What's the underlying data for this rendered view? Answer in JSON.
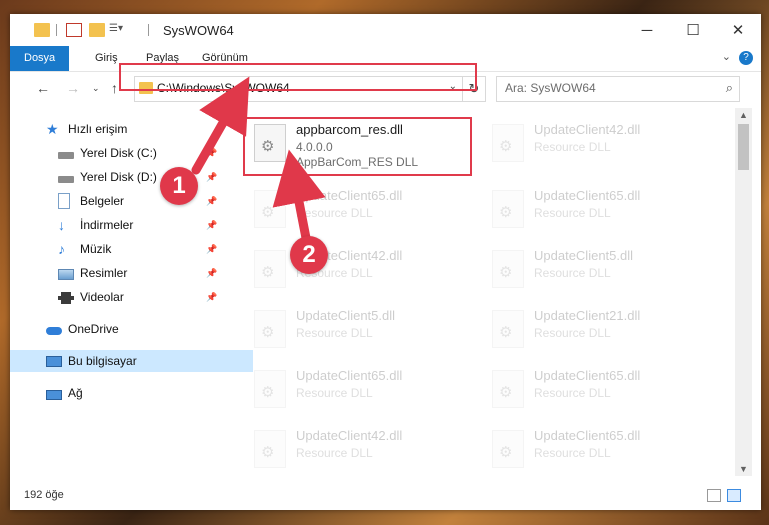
{
  "window": {
    "title": "SysWOW64"
  },
  "ribbon": {
    "tabs": [
      {
        "label": "Dosya",
        "active": true
      },
      {
        "label": "Giriş",
        "active": false
      },
      {
        "label": "Paylaş",
        "active": false
      },
      {
        "label": "Görünüm",
        "active": false
      }
    ]
  },
  "address": {
    "path": "C:\\Windows\\SysWOW64"
  },
  "search": {
    "placeholder": "Ara: SysWOW64"
  },
  "sidebar": {
    "items": [
      {
        "label": "Hızlı erişim",
        "icon": "star-icon"
      },
      {
        "label": "Yerel Disk (C:)",
        "icon": "drive-icon"
      },
      {
        "label": "Yerel Disk (D:)",
        "icon": "drive-icon"
      },
      {
        "label": "Belgeler",
        "icon": "document-icon"
      },
      {
        "label": "İndirmeler",
        "icon": "download-icon"
      },
      {
        "label": "Müzik",
        "icon": "music-icon"
      },
      {
        "label": "Resimler",
        "icon": "pictures-icon"
      },
      {
        "label": "Videolar",
        "icon": "video-icon"
      },
      {
        "label": "OneDrive",
        "icon": "cloud-icon"
      },
      {
        "label": "Bu bilgisayar",
        "icon": "computer-icon"
      },
      {
        "label": "Ağ",
        "icon": "network-icon"
      }
    ]
  },
  "files": {
    "highlighted": {
      "name": "appbarcom_res.dll",
      "version": "4.0.0.0",
      "description": "AppBarCom_RES DLL"
    },
    "background": [
      {
        "name": "UpdateClient42.dll",
        "description": "Resource DLL"
      },
      {
        "name": "UpdateClient65.dll",
        "description": "Resource DLL"
      },
      {
        "name": "UpdateClient65.dll",
        "description": "Resource DLL"
      },
      {
        "name": "UpdateClient42.dll",
        "description": "Resource DLL"
      },
      {
        "name": "UpdateClient5.dll",
        "description": "Resource DLL"
      },
      {
        "name": "UpdateClient5.dll",
        "description": "Resource DLL"
      },
      {
        "name": "UpdateClient21.dll",
        "description": "Resource DLL"
      },
      {
        "name": "UpdateClient65.dll",
        "description": "Resource DLL"
      },
      {
        "name": "UpdateClient65.dll",
        "description": "Resource DLL"
      },
      {
        "name": "UpdateClient42.dll",
        "description": "Resource DLL"
      },
      {
        "name": "UpdateClient65.dll",
        "description": "Resource DLL"
      }
    ]
  },
  "status": {
    "item_count": "192 öğe"
  },
  "callouts": {
    "one": "1",
    "two": "2"
  },
  "colors": {
    "accent": "#1979ca",
    "highlight": "#e03a4b",
    "selected": "#cce8ff"
  }
}
